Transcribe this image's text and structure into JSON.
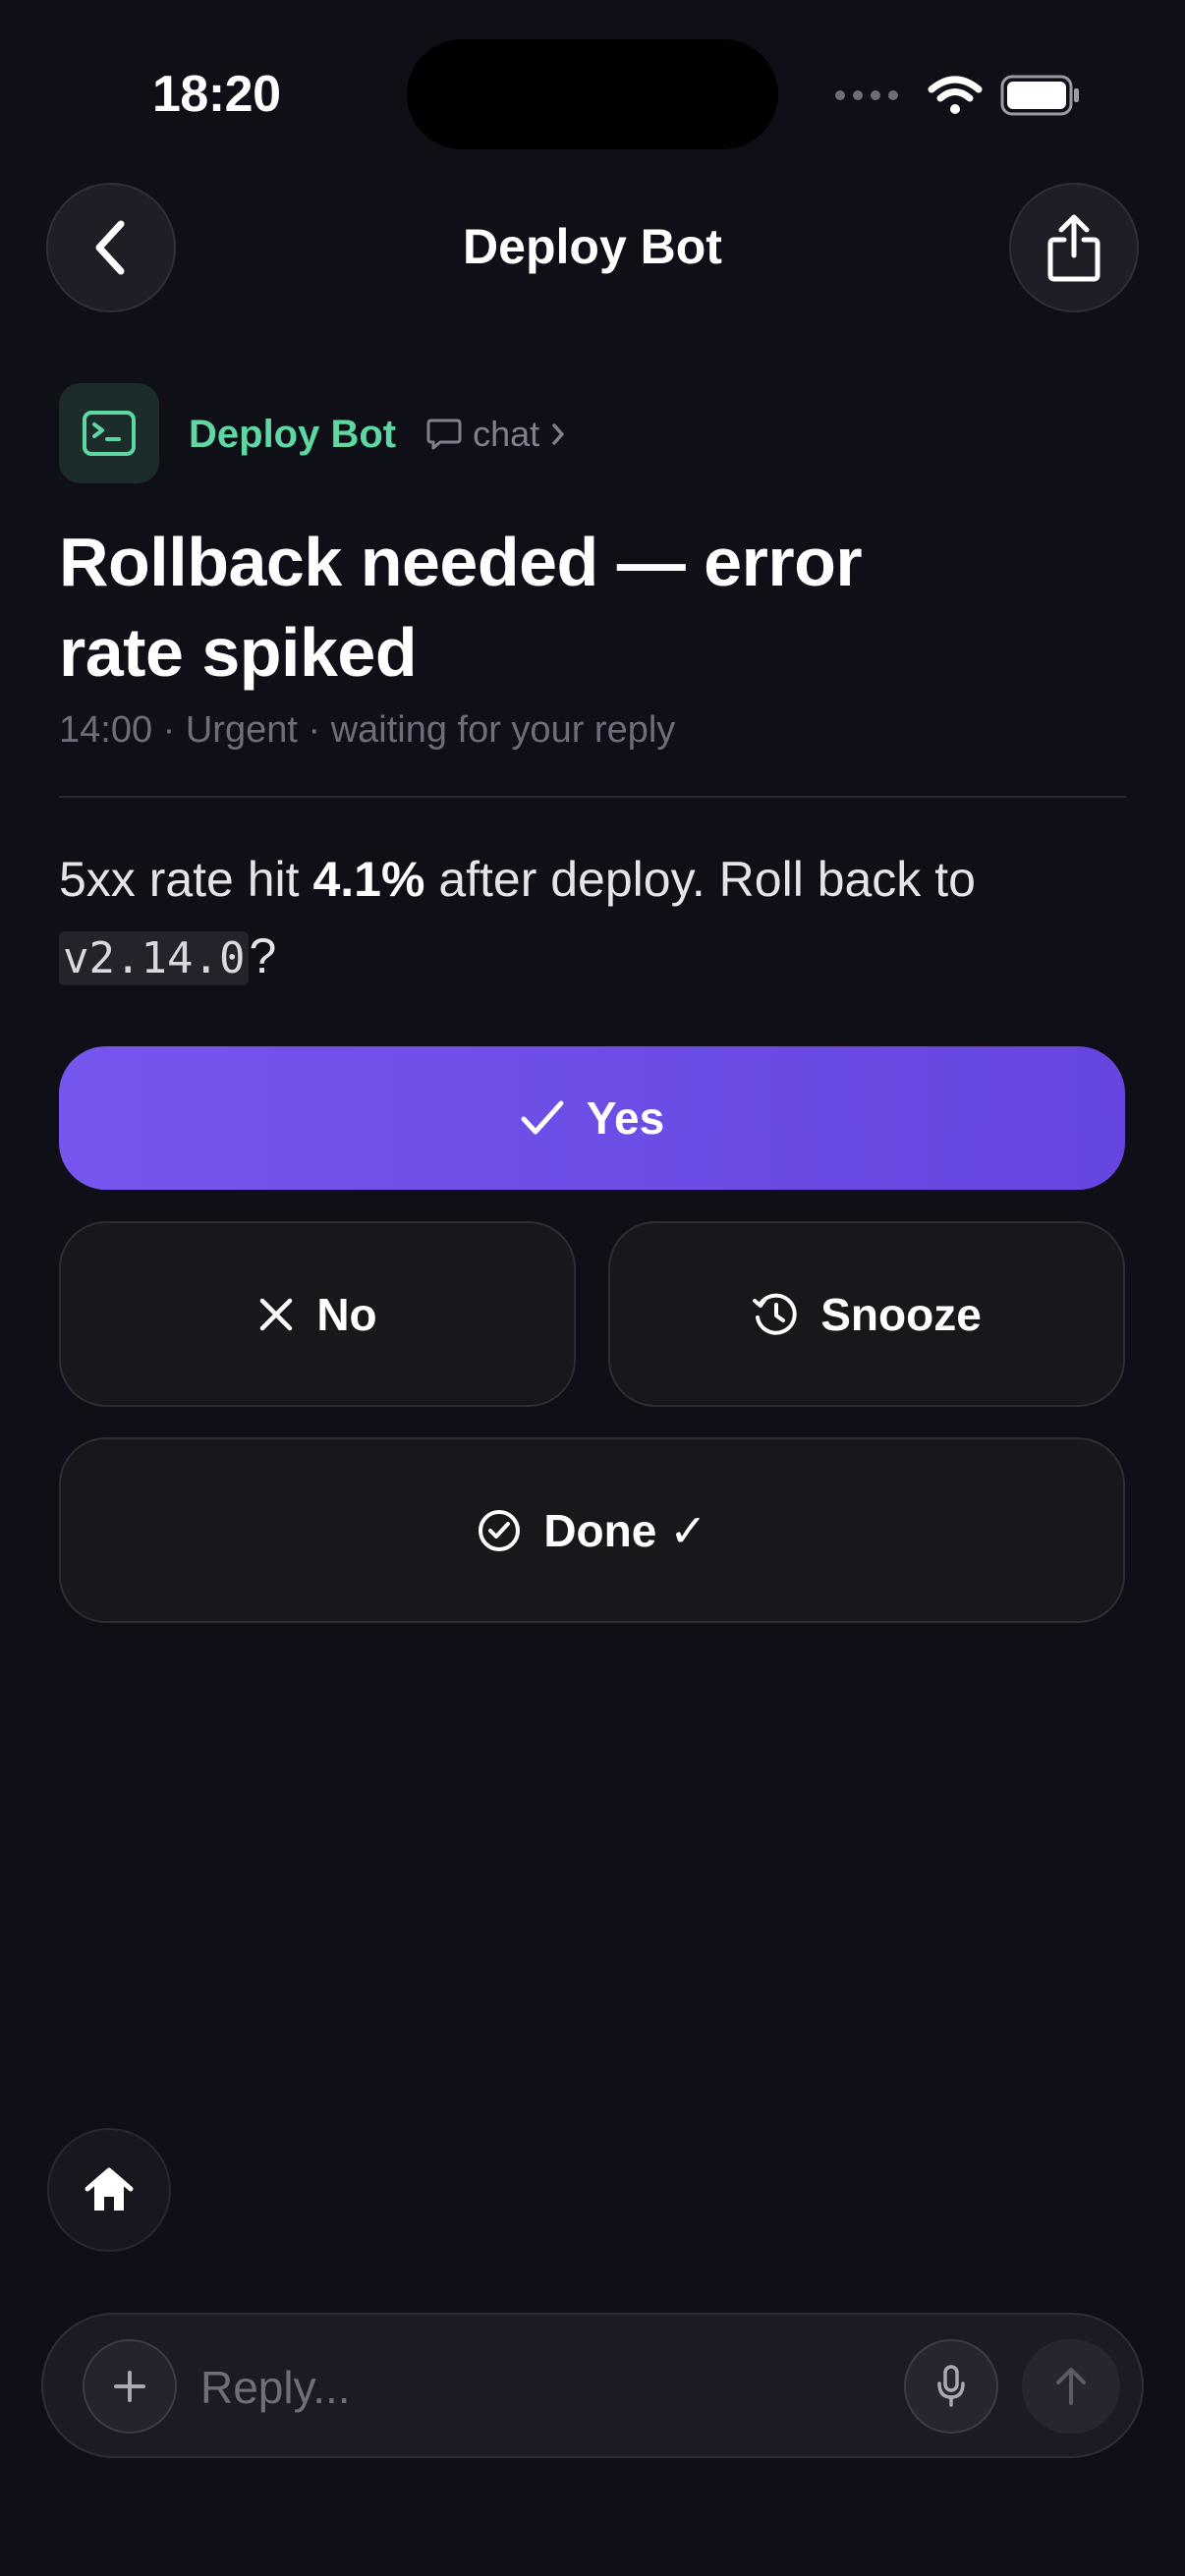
{
  "status_bar": {
    "time": "18:20"
  },
  "nav": {
    "title": "Deploy Bot"
  },
  "sender": {
    "name": "Deploy Bot",
    "channel": "chat"
  },
  "message": {
    "title": "Rollback needed — error rate spiked",
    "meta": "14:00 · Urgent · waiting for your reply",
    "body_prefix": "5xx rate hit ",
    "body_bold": "4.1%",
    "body_mid": " after deploy. Roll back to ",
    "body_code": "v2.14.0",
    "body_suffix": "?"
  },
  "actions": {
    "yes": "Yes",
    "no": "No",
    "snooze": "Snooze",
    "done": "Done ✓"
  },
  "composer": {
    "placeholder": "Reply..."
  },
  "colors": {
    "background": "#0f1017",
    "accent": "#7656ee",
    "sender": "#5ed7a2"
  },
  "icons": {
    "back": "chevron-left-icon",
    "share": "share-icon",
    "avatar": "terminal-icon",
    "channel": "chat-bubble-icon",
    "yes": "checkmark-icon",
    "no": "x-icon",
    "snooze": "history-icon",
    "done": "check-circle-icon",
    "home": "home-icon",
    "plus": "plus-icon",
    "mic": "microphone-icon",
    "send": "arrow-up-icon"
  }
}
